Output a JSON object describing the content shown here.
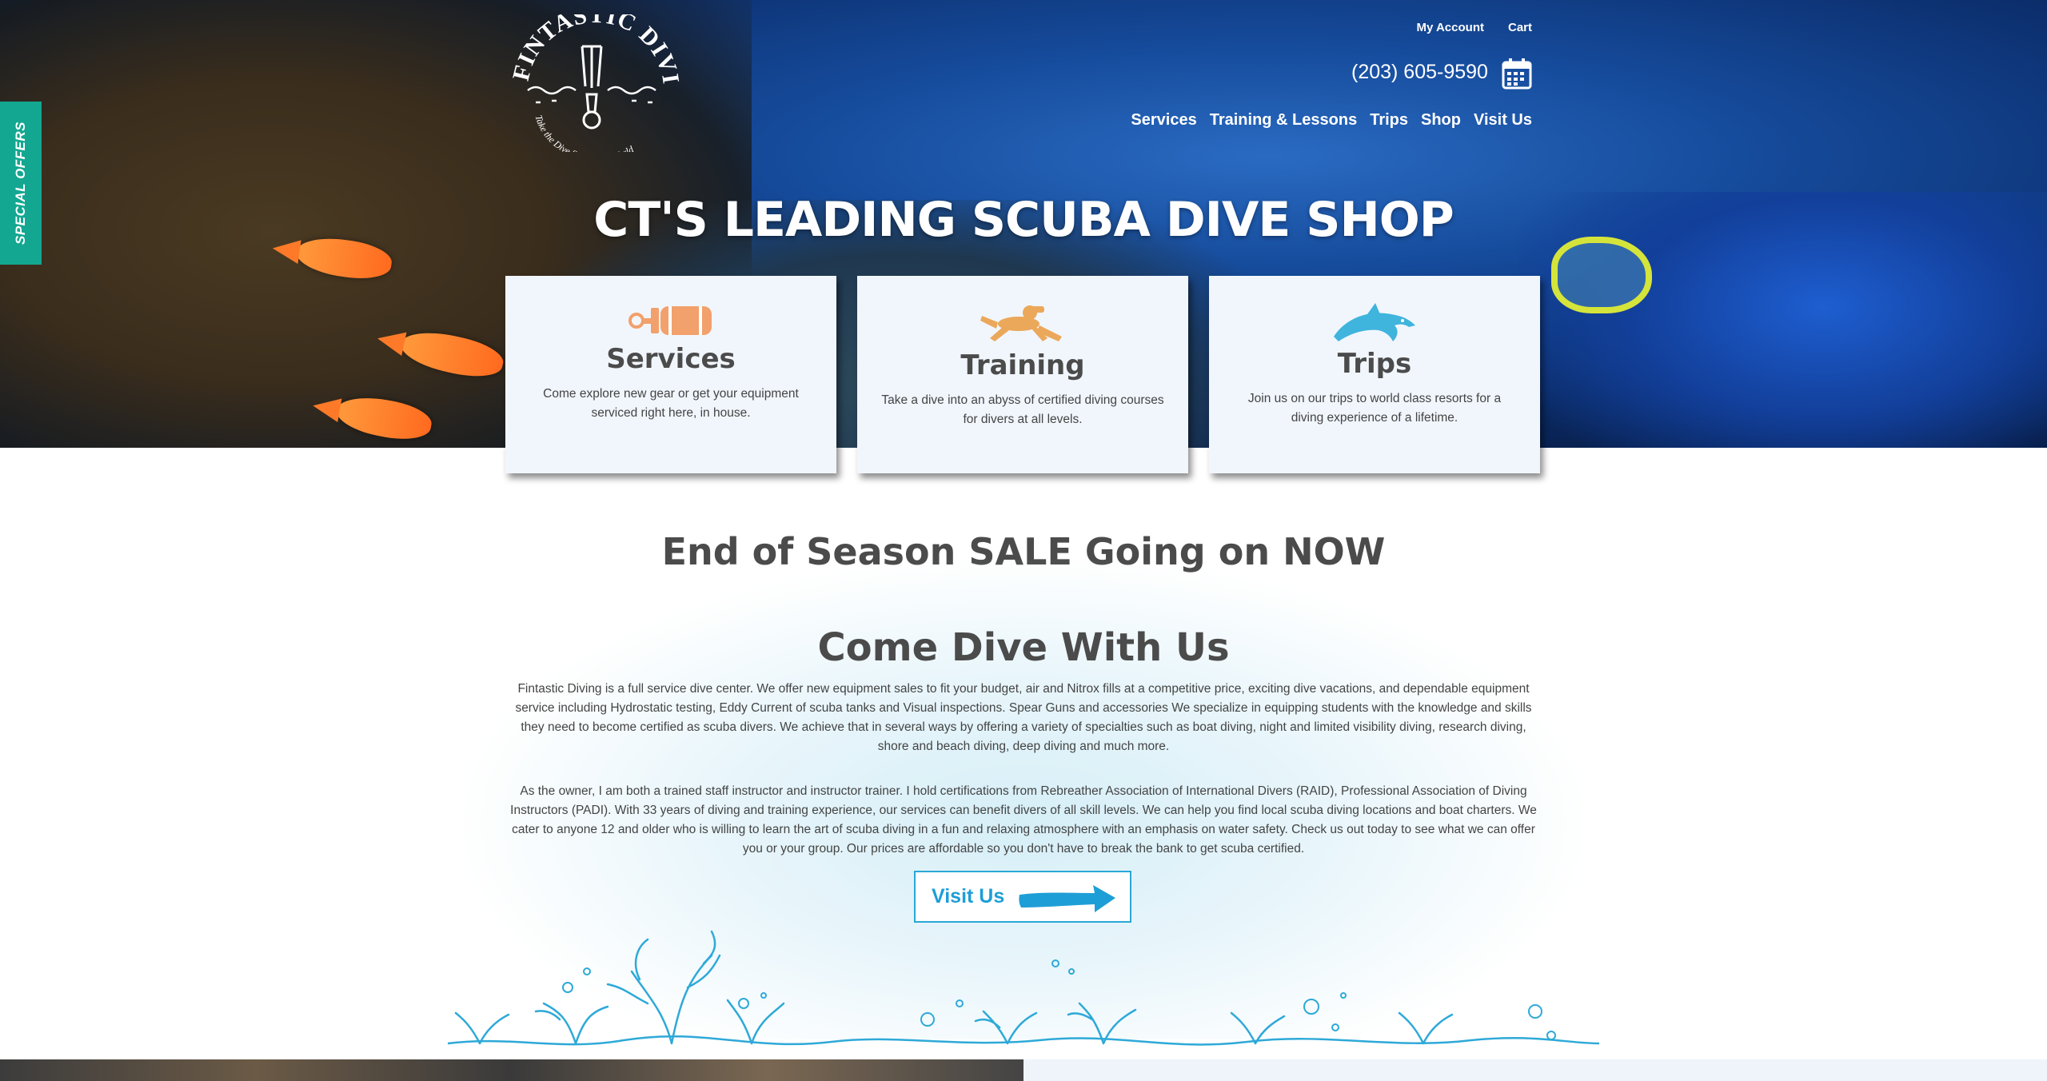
{
  "header": {
    "logo": {
      "text": "FINTASTIC DIVING",
      "tagline": "Take the Dive Sea a New World"
    },
    "top_links": [
      "My Account",
      "Cart"
    ],
    "phone": "(203) 605-9590",
    "nav": [
      "Services",
      "Training & Lessons",
      "Trips",
      "Shop",
      "Visit Us"
    ]
  },
  "special_offers": "SPECIAL OFFERS",
  "hero": {
    "title": "CT'S LEADING SCUBA DIVE SHOP"
  },
  "cards": [
    {
      "icon": "scuba-tank-icon",
      "title": "Services",
      "text": "Come explore new gear or get your equipment serviced right here, in house."
    },
    {
      "icon": "diver-icon",
      "title": "Training",
      "text": "Take a dive into an abyss of certified diving courses for divers at all levels."
    },
    {
      "icon": "dolphin-icon",
      "title": "Trips",
      "text": "Join us on our trips to world class resorts for a diving experience of a lifetime."
    }
  ],
  "sale_heading": "End of Season SALE Going on NOW",
  "section_title": "Come Dive With Us",
  "paragraphs": [
    "Fintastic Diving is a full service dive center. We offer new equipment sales to fit your budget, air and Nitrox fills at a competitive price, exciting dive vacations, and dependable equipment service including Hydrostatic testing, Eddy Current of scuba tanks and Visual inspections. Spear Guns and accessories We specialize in equipping students with the knowledge and skills they need to become certified as scuba divers. We achieve that in several ways by offering a variety of specialties such as boat diving, night and limited visibility diving, research diving, shore and beach diving, deep diving and much more.",
    "As the owner, I am both a trained staff instructor and instructor trainer. I hold certifications from Rebreather Association of International Divers (RAID), Professional Association of Diving Instructors (PADI). With 33 years of diving and training experience, our services can benefit divers of all skill levels. We can help you find local scuba diving locations and boat charters. We cater to anyone 12 and older who is willing to learn the art of scuba diving in a fun and relaxing atmosphere with an emphasis on water safety. Check us out today to see what we can offer you or your group. Our prices are affordable so you don't have to break the bank to get scuba certified."
  ],
  "visit_button": "Visit Us",
  "colors": {
    "teal_tab": "#13a791",
    "accent_blue": "#1e9ed6",
    "card_bg": "#f1f6fd",
    "heading": "#4b4b4b"
  }
}
